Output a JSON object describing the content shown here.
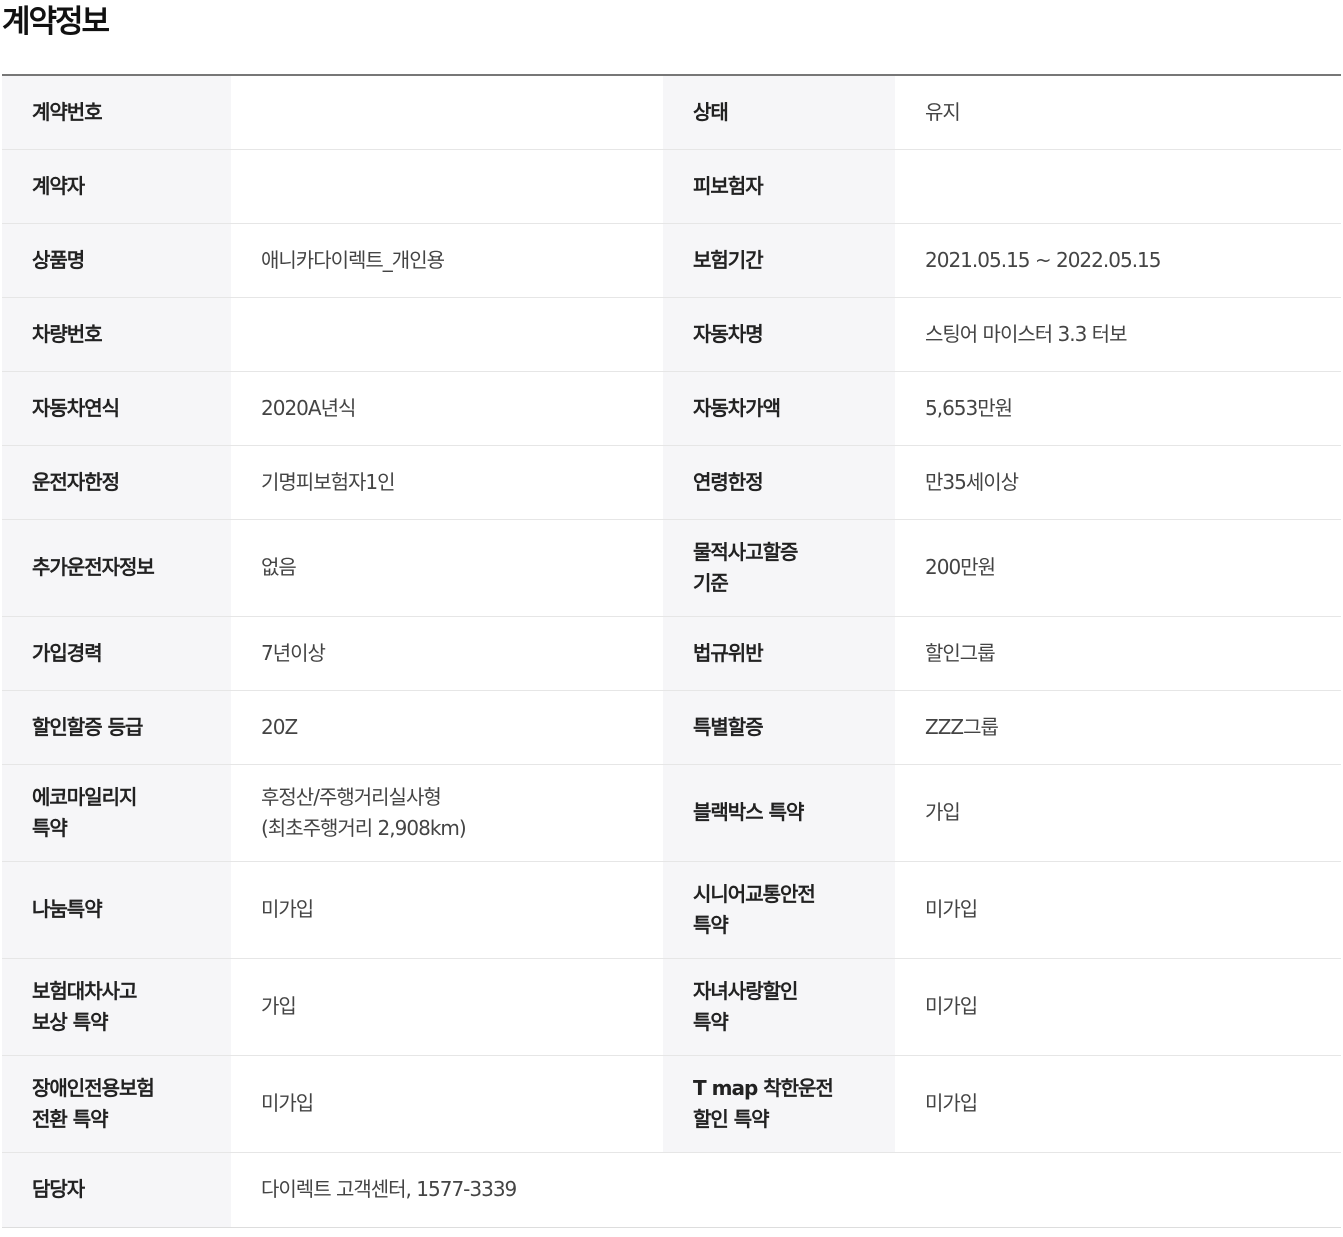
{
  "page": {
    "title": "계약정보"
  },
  "contract": {
    "contract_number": {
      "label": "계약번호",
      "value": ""
    },
    "status": {
      "label": "상태",
      "value": "유지"
    },
    "contractor": {
      "label": "계약자",
      "value": ""
    },
    "insured": {
      "label": "피보험자",
      "value": ""
    },
    "product_name": {
      "label": "상품명",
      "value": "애니카다이렉트_개인용"
    },
    "insurance_period": {
      "label": "보험기간",
      "value": "2021.05.15 ~ 2022.05.15"
    },
    "vehicle_number": {
      "label": "차량번호",
      "value": ""
    },
    "vehicle_name": {
      "label": "자동차명",
      "value": "스팅어 마이스터 3.3 터보"
    },
    "vehicle_year": {
      "label": "자동차연식",
      "value": "2020A년식"
    },
    "vehicle_price": {
      "label": "자동차가액",
      "value": "5,653만원"
    },
    "driver_limit": {
      "label": "운전자한정",
      "value": "기명피보험자1인"
    },
    "age_limit": {
      "label": "연령한정",
      "value": "만35세이상"
    },
    "additional_driver": {
      "label": "추가운전자정보",
      "value": "없음"
    },
    "property_accident_standard": {
      "label_line1": "물적사고할증",
      "label_line2": "기준",
      "value": "200만원"
    },
    "insurance_career": {
      "label": "가입경력",
      "value": "7년이상"
    },
    "law_violation": {
      "label": "법규위반",
      "value": "할인그룹"
    },
    "discount_grade": {
      "label": "할인할증 등급",
      "value": "20Z"
    },
    "special_surcharge": {
      "label": "특별할증",
      "value": "ZZZ그룹"
    },
    "eco_mileage": {
      "label_line1": "에코마일리지",
      "label_line2": "특약",
      "value_line1": "후정산/주행거리실사형",
      "value_line2": "(최초주행거리 2,908km)"
    },
    "blackbox": {
      "label": "블랙박스 특약",
      "value": "가입"
    },
    "sharing": {
      "label": "나눔특약",
      "value": "미가입"
    },
    "senior_safety": {
      "label_line1": "시니어교통안전",
      "label_line2": "특약",
      "value": "미가입"
    },
    "rental_compensation": {
      "label_line1": "보험대차사고",
      "label_line2": "보상 특약",
      "value": "가입"
    },
    "child_love_discount": {
      "label_line1": "자녀사랑할인",
      "label_line2": "특약",
      "value": "미가입"
    },
    "disabled_conversion": {
      "label_line1": "장애인전용보험",
      "label_line2": "전환 특약",
      "value": "미가입"
    },
    "tmap_safe_driving": {
      "label_line1": "T map 착한운전",
      "label_line2": "할인 특약",
      "value": "미가입"
    },
    "manager": {
      "label": "담당자",
      "value": "다이렉트 고객센터, 1577-3339"
    }
  }
}
